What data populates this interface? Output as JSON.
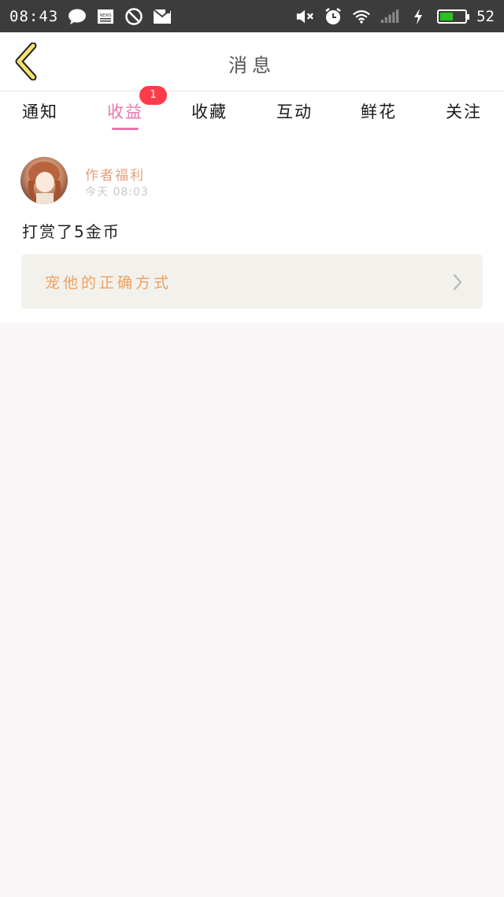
{
  "status_bar": {
    "time": "08:43",
    "battery_percent": "52",
    "battery_level": 0.52,
    "icons": [
      "message-icon",
      "news-icon",
      "block-icon",
      "mail-icon",
      "mute-icon",
      "alarm-icon",
      "wifi-icon",
      "signal-icon",
      "charging-icon",
      "battery-icon"
    ]
  },
  "header": {
    "title": "消息",
    "back_icon": "chevron-left-icon"
  },
  "tabs": [
    {
      "label": "通知"
    },
    {
      "label": "收益",
      "active": true,
      "badge": "1"
    },
    {
      "label": "收藏"
    },
    {
      "label": "互动"
    },
    {
      "label": "鲜花"
    },
    {
      "label": "关注"
    }
  ],
  "message": {
    "author": "作者福利",
    "time": "今天 08:03",
    "text": "打赏了5金币",
    "link_text": "宠他的正确方式"
  },
  "colors": {
    "accent": "#e676ac",
    "badge": "#ff3b4a",
    "author": "#e8a07c",
    "link": "#eea05e"
  }
}
